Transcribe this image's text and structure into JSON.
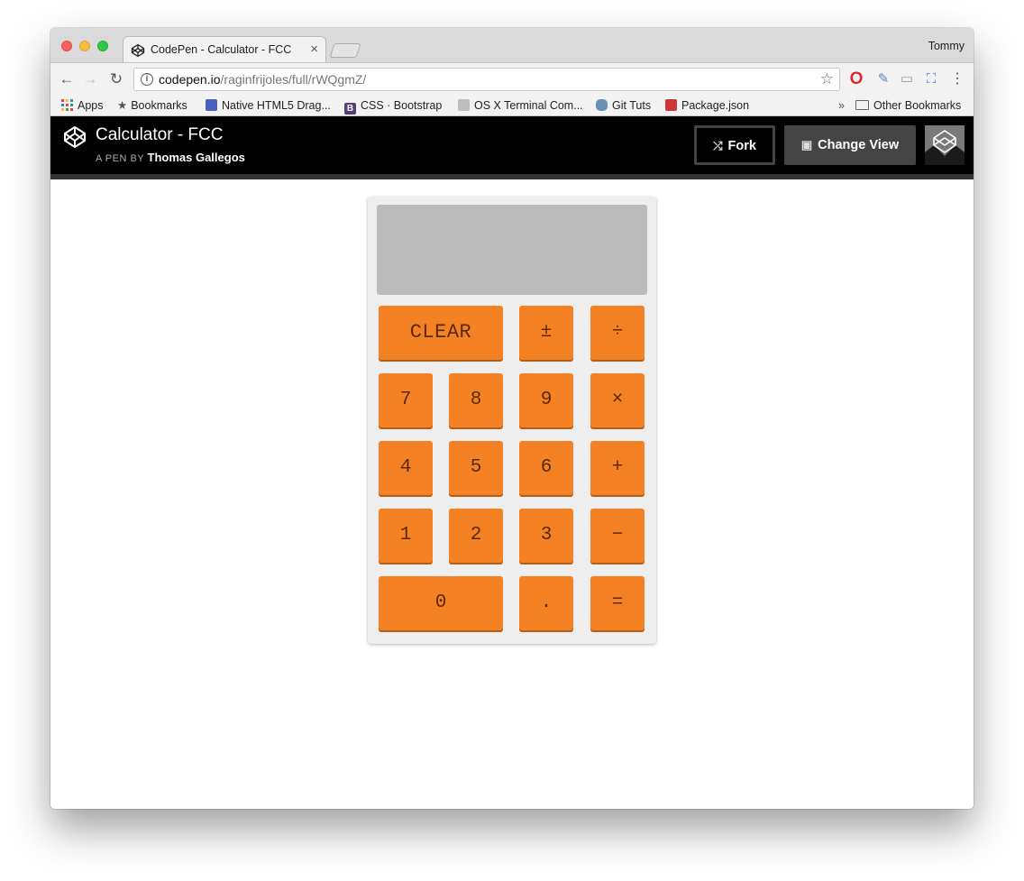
{
  "browser": {
    "tab_title": "CodePen - Calculator - FCC",
    "tab_close": "×",
    "profile_name": "Tommy",
    "url_host": "codepen.io",
    "url_path": "/raginfrijoles/full/rWQgmZ/",
    "bookmarks": {
      "apps": "Apps",
      "bookmarks": "Bookmarks",
      "html5": "Native HTML5 Drag...",
      "css": "CSS · Bootstrap",
      "osx": "OS X Terminal Com...",
      "git": "Git Tuts",
      "pkg": "Package.json",
      "more": "»",
      "other": "Other Bookmarks"
    }
  },
  "codepen": {
    "title": "Calculator - FCC",
    "byline_prefix": "A PEN BY",
    "author": "Thomas Gallegos",
    "fork_label": "Fork",
    "change_view_label": "Change View"
  },
  "calculator": {
    "display": "",
    "keys": {
      "clear": "CLEAR",
      "negate": "±",
      "divide": "÷",
      "seven": "7",
      "eight": "8",
      "nine": "9",
      "multiply": "×",
      "four": "4",
      "five": "5",
      "six": "6",
      "add": "+",
      "one": "1",
      "two": "2",
      "three": "3",
      "subtract": "−",
      "zero": "0",
      "decimal": ".",
      "equals": "="
    }
  },
  "colors": {
    "key_orange": "#f48225",
    "display_gray": "#bbbbbb",
    "codepen_header": "#000000"
  }
}
